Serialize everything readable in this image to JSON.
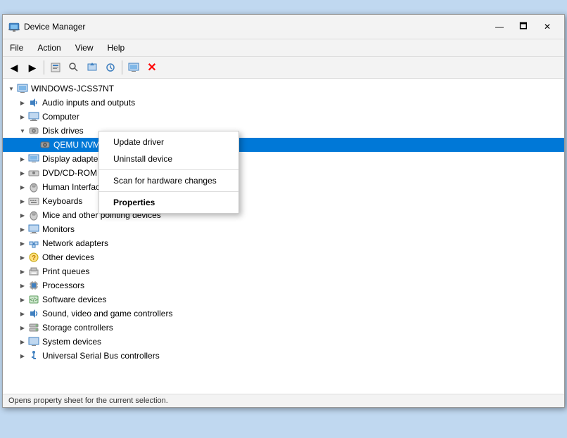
{
  "window": {
    "title": "Device Manager",
    "icon": "🖥",
    "min": "—",
    "max": "🗖",
    "close": "✕"
  },
  "menu": {
    "items": [
      "File",
      "Action",
      "View",
      "Help"
    ]
  },
  "toolbar": {
    "buttons": [
      "◀",
      "▶",
      "↑",
      "🖥",
      "🔍",
      "🖨",
      "🔧",
      "❌"
    ]
  },
  "tree": {
    "root": "WINDOWS-JCSS7NT",
    "items": [
      {
        "label": "Audio inputs and outputs",
        "indent": 1,
        "expand": false,
        "icon": "🔊"
      },
      {
        "label": "Computer",
        "indent": 1,
        "expand": false,
        "icon": "🖥"
      },
      {
        "label": "Disk drives",
        "indent": 1,
        "expand": true,
        "icon": "💾"
      },
      {
        "label": "QEMU NVMe Ctrl",
        "indent": 2,
        "expand": false,
        "icon": "💿",
        "selected": true
      },
      {
        "label": "Display adapters",
        "indent": 1,
        "expand": false,
        "icon": "🖥"
      },
      {
        "label": "DVD/CD-ROM drives",
        "indent": 1,
        "expand": false,
        "icon": "💿"
      },
      {
        "label": "Human Interface Devices",
        "indent": 1,
        "expand": false,
        "icon": "🖱"
      },
      {
        "label": "Keyboards",
        "indent": 1,
        "expand": false,
        "icon": "⌨"
      },
      {
        "label": "Mice and other pointing devices",
        "indent": 1,
        "expand": false,
        "icon": "🖱"
      },
      {
        "label": "Monitors",
        "indent": 1,
        "expand": false,
        "icon": "🖥"
      },
      {
        "label": "Network adapters",
        "indent": 1,
        "expand": false,
        "icon": "🌐"
      },
      {
        "label": "Other devices",
        "indent": 1,
        "expand": false,
        "icon": "❓"
      },
      {
        "label": "Print queues",
        "indent": 1,
        "expand": false,
        "icon": "🖨"
      },
      {
        "label": "Processors",
        "indent": 1,
        "expand": false,
        "icon": "⚙"
      },
      {
        "label": "Software devices",
        "indent": 1,
        "expand": false,
        "icon": "💻"
      },
      {
        "label": "Sound, video and game controllers",
        "indent": 1,
        "expand": false,
        "icon": "🔊"
      },
      {
        "label": "Storage controllers",
        "indent": 1,
        "expand": false,
        "icon": "💾"
      },
      {
        "label": "System devices",
        "indent": 1,
        "expand": false,
        "icon": "🖥"
      },
      {
        "label": "Universal Serial Bus controllers",
        "indent": 1,
        "expand": false,
        "icon": "🔌"
      }
    ]
  },
  "contextMenu": {
    "items": [
      {
        "label": "Update driver",
        "type": "normal"
      },
      {
        "label": "Uninstall device",
        "type": "normal"
      },
      {
        "type": "separator"
      },
      {
        "label": "Scan for hardware changes",
        "type": "normal"
      },
      {
        "type": "separator"
      },
      {
        "label": "Properties",
        "type": "bold"
      }
    ]
  },
  "statusBar": {
    "text": "Opens property sheet for the current selection."
  }
}
